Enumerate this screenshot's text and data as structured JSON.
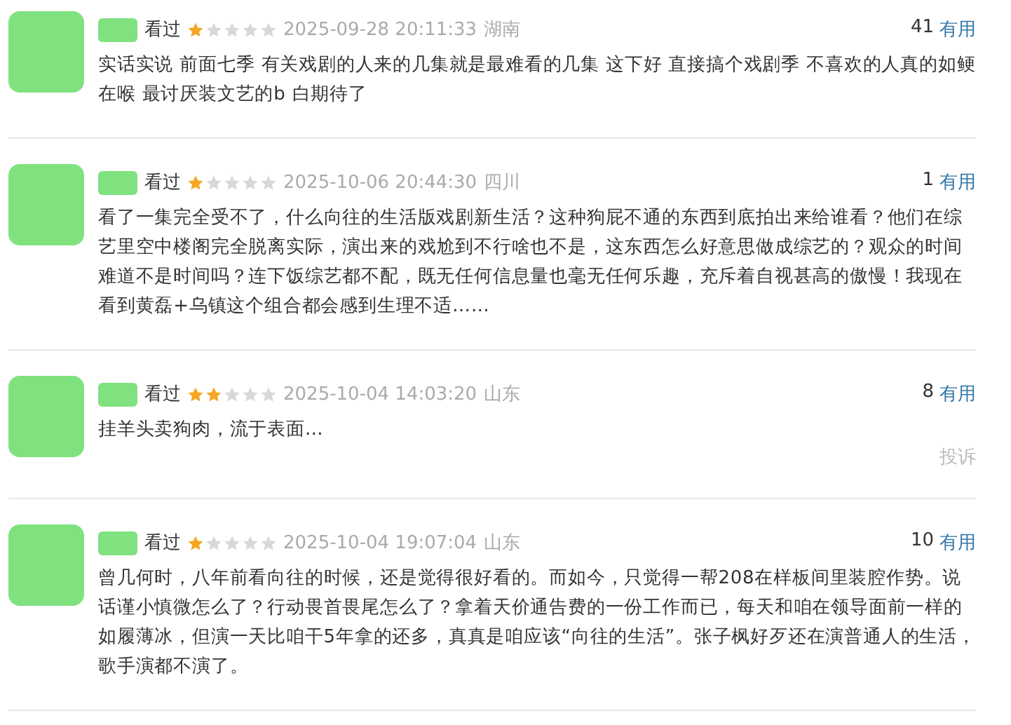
{
  "reviews": [
    {
      "status": "看过",
      "stars": 1,
      "time": "2025-09-28 20:11:33",
      "location": "湖南",
      "votes": "41",
      "vote_label": "有用",
      "text": "实话实说 前面七季 有关戏剧的人来的几集就是最难看的几集 这下好 直接搞个戏剧季 不喜欢的人真的如鲠在喉 最讨厌装文艺的b 白期待了"
    },
    {
      "status": "看过",
      "stars": 1,
      "time": "2025-10-06 20:44:30",
      "location": "四川",
      "votes": "1",
      "vote_label": "有用",
      "text": "看了一集完全受不了，什么向往的生活版戏剧新生活？这种狗屁不通的东西到底拍出来给谁看？他们在综艺里空中楼阁完全脱离实际，演出来的戏尬到不行啥也不是，这东西怎么好意思做成综艺的？观众的时间难道不是时间吗？连下饭综艺都不配，既无任何信息量也毫无任何乐趣，充斥着自视甚高的傲慢！我现在看到黄磊+乌镇这个组合都会感到生理不适……"
    },
    {
      "status": "看过",
      "stars": 2,
      "time": "2025-10-04 14:03:20",
      "location": "山东",
      "votes": "8",
      "vote_label": "有用",
      "text": "挂羊头卖狗肉，流于表面…",
      "report": "投诉"
    },
    {
      "status": "看过",
      "stars": 1,
      "time": "2025-10-04 19:07:04",
      "location": "山东",
      "votes": "10",
      "vote_label": "有用",
      "text": "曾几何时，八年前看向往的时候，还是觉得很好看的。而如今，只觉得一帮208在样板间里装腔作势。说话谨小慎微怎么了？行动畏首畏尾怎么了？拿着天价通告费的一份工作而已，每天和咱在领导面前一样的如履薄冰，但演一天比咱干5年拿的还多，真真是咱应该“向往的生活”。张子枫好歹还在演普通人的生活，歌手演都不演了。"
    }
  ]
}
